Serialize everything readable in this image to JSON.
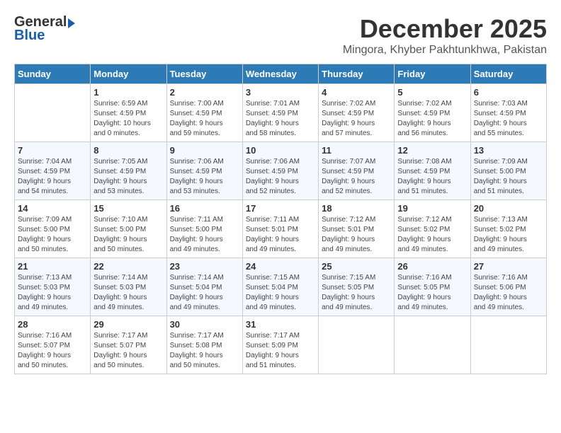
{
  "logo": {
    "general": "General",
    "blue": "Blue"
  },
  "title": {
    "month": "December 2025",
    "location": "Mingora, Khyber Pakhtunkhwa, Pakistan"
  },
  "weekdays": [
    "Sunday",
    "Monday",
    "Tuesday",
    "Wednesday",
    "Thursday",
    "Friday",
    "Saturday"
  ],
  "weeks": [
    [
      {
        "day": "",
        "sunrise": "",
        "sunset": "",
        "daylight": ""
      },
      {
        "day": "1",
        "sunrise": "Sunrise: 6:59 AM",
        "sunset": "Sunset: 4:59 PM",
        "daylight": "Daylight: 10 hours and 0 minutes."
      },
      {
        "day": "2",
        "sunrise": "Sunrise: 7:00 AM",
        "sunset": "Sunset: 4:59 PM",
        "daylight": "Daylight: 9 hours and 59 minutes."
      },
      {
        "day": "3",
        "sunrise": "Sunrise: 7:01 AM",
        "sunset": "Sunset: 4:59 PM",
        "daylight": "Daylight: 9 hours and 58 minutes."
      },
      {
        "day": "4",
        "sunrise": "Sunrise: 7:02 AM",
        "sunset": "Sunset: 4:59 PM",
        "daylight": "Daylight: 9 hours and 57 minutes."
      },
      {
        "day": "5",
        "sunrise": "Sunrise: 7:02 AM",
        "sunset": "Sunset: 4:59 PM",
        "daylight": "Daylight: 9 hours and 56 minutes."
      },
      {
        "day": "6",
        "sunrise": "Sunrise: 7:03 AM",
        "sunset": "Sunset: 4:59 PM",
        "daylight": "Daylight: 9 hours and 55 minutes."
      }
    ],
    [
      {
        "day": "7",
        "sunrise": "Sunrise: 7:04 AM",
        "sunset": "Sunset: 4:59 PM",
        "daylight": "Daylight: 9 hours and 54 minutes."
      },
      {
        "day": "8",
        "sunrise": "Sunrise: 7:05 AM",
        "sunset": "Sunset: 4:59 PM",
        "daylight": "Daylight: 9 hours and 53 minutes."
      },
      {
        "day": "9",
        "sunrise": "Sunrise: 7:06 AM",
        "sunset": "Sunset: 4:59 PM",
        "daylight": "Daylight: 9 hours and 53 minutes."
      },
      {
        "day": "10",
        "sunrise": "Sunrise: 7:06 AM",
        "sunset": "Sunset: 4:59 PM",
        "daylight": "Daylight: 9 hours and 52 minutes."
      },
      {
        "day": "11",
        "sunrise": "Sunrise: 7:07 AM",
        "sunset": "Sunset: 4:59 PM",
        "daylight": "Daylight: 9 hours and 52 minutes."
      },
      {
        "day": "12",
        "sunrise": "Sunrise: 7:08 AM",
        "sunset": "Sunset: 4:59 PM",
        "daylight": "Daylight: 9 hours and 51 minutes."
      },
      {
        "day": "13",
        "sunrise": "Sunrise: 7:09 AM",
        "sunset": "Sunset: 5:00 PM",
        "daylight": "Daylight: 9 hours and 51 minutes."
      }
    ],
    [
      {
        "day": "14",
        "sunrise": "Sunrise: 7:09 AM",
        "sunset": "Sunset: 5:00 PM",
        "daylight": "Daylight: 9 hours and 50 minutes."
      },
      {
        "day": "15",
        "sunrise": "Sunrise: 7:10 AM",
        "sunset": "Sunset: 5:00 PM",
        "daylight": "Daylight: 9 hours and 50 minutes."
      },
      {
        "day": "16",
        "sunrise": "Sunrise: 7:11 AM",
        "sunset": "Sunset: 5:00 PM",
        "daylight": "Daylight: 9 hours and 49 minutes."
      },
      {
        "day": "17",
        "sunrise": "Sunrise: 7:11 AM",
        "sunset": "Sunset: 5:01 PM",
        "daylight": "Daylight: 9 hours and 49 minutes."
      },
      {
        "day": "18",
        "sunrise": "Sunrise: 7:12 AM",
        "sunset": "Sunset: 5:01 PM",
        "daylight": "Daylight: 9 hours and 49 minutes."
      },
      {
        "day": "19",
        "sunrise": "Sunrise: 7:12 AM",
        "sunset": "Sunset: 5:02 PM",
        "daylight": "Daylight: 9 hours and 49 minutes."
      },
      {
        "day": "20",
        "sunrise": "Sunrise: 7:13 AM",
        "sunset": "Sunset: 5:02 PM",
        "daylight": "Daylight: 9 hours and 49 minutes."
      }
    ],
    [
      {
        "day": "21",
        "sunrise": "Sunrise: 7:13 AM",
        "sunset": "Sunset: 5:03 PM",
        "daylight": "Daylight: 9 hours and 49 minutes."
      },
      {
        "day": "22",
        "sunrise": "Sunrise: 7:14 AM",
        "sunset": "Sunset: 5:03 PM",
        "daylight": "Daylight: 9 hours and 49 minutes."
      },
      {
        "day": "23",
        "sunrise": "Sunrise: 7:14 AM",
        "sunset": "Sunset: 5:04 PM",
        "daylight": "Daylight: 9 hours and 49 minutes."
      },
      {
        "day": "24",
        "sunrise": "Sunrise: 7:15 AM",
        "sunset": "Sunset: 5:04 PM",
        "daylight": "Daylight: 9 hours and 49 minutes."
      },
      {
        "day": "25",
        "sunrise": "Sunrise: 7:15 AM",
        "sunset": "Sunset: 5:05 PM",
        "daylight": "Daylight: 9 hours and 49 minutes."
      },
      {
        "day": "26",
        "sunrise": "Sunrise: 7:16 AM",
        "sunset": "Sunset: 5:05 PM",
        "daylight": "Daylight: 9 hours and 49 minutes."
      },
      {
        "day": "27",
        "sunrise": "Sunrise: 7:16 AM",
        "sunset": "Sunset: 5:06 PM",
        "daylight": "Daylight: 9 hours and 49 minutes."
      }
    ],
    [
      {
        "day": "28",
        "sunrise": "Sunrise: 7:16 AM",
        "sunset": "Sunset: 5:07 PM",
        "daylight": "Daylight: 9 hours and 50 minutes."
      },
      {
        "day": "29",
        "sunrise": "Sunrise: 7:17 AM",
        "sunset": "Sunset: 5:07 PM",
        "daylight": "Daylight: 9 hours and 50 minutes."
      },
      {
        "day": "30",
        "sunrise": "Sunrise: 7:17 AM",
        "sunset": "Sunset: 5:08 PM",
        "daylight": "Daylight: 9 hours and 50 minutes."
      },
      {
        "day": "31",
        "sunrise": "Sunrise: 7:17 AM",
        "sunset": "Sunset: 5:09 PM",
        "daylight": "Daylight: 9 hours and 51 minutes."
      },
      {
        "day": "",
        "sunrise": "",
        "sunset": "",
        "daylight": ""
      },
      {
        "day": "",
        "sunrise": "",
        "sunset": "",
        "daylight": ""
      },
      {
        "day": "",
        "sunrise": "",
        "sunset": "",
        "daylight": ""
      }
    ]
  ]
}
